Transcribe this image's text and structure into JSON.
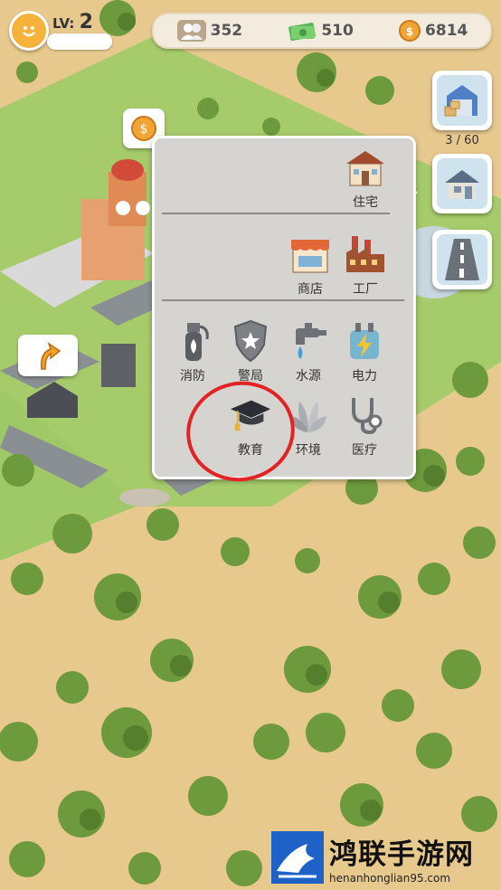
{
  "hud": {
    "level_prefix": "LV:",
    "level": "2",
    "population": "352",
    "cash": "510",
    "coins": "6814"
  },
  "side": {
    "warehouse_count": "3 / 60",
    "buttons": [
      "warehouse-icon",
      "house-build-icon",
      "road-icon"
    ]
  },
  "menu": {
    "residential": [
      {
        "label": "住宅",
        "icon": "house-icon"
      }
    ],
    "commercial": [
      {
        "label": "商店",
        "icon": "shop-icon"
      },
      {
        "label": "工厂",
        "icon": "factory-icon"
      }
    ],
    "services": [
      {
        "label": "消防",
        "icon": "fire-extinguisher-icon"
      },
      {
        "label": "警局",
        "icon": "police-badge-icon"
      },
      {
        "label": "水源",
        "icon": "water-tap-icon"
      },
      {
        "label": "电力",
        "icon": "power-icon"
      },
      {
        "label": "教育",
        "icon": "graduation-cap-icon"
      },
      {
        "label": "环境",
        "icon": "leaf-icon"
      },
      {
        "label": "医疗",
        "icon": "stethoscope-icon"
      }
    ]
  },
  "watermark": {
    "title": "鸿联手游网",
    "url": "henanhonglian95.com"
  },
  "colors": {
    "highlight_ring": "#e32323",
    "panel": "#d6d4d0",
    "grass": "#9fc866",
    "sand": "#e7c98e"
  }
}
